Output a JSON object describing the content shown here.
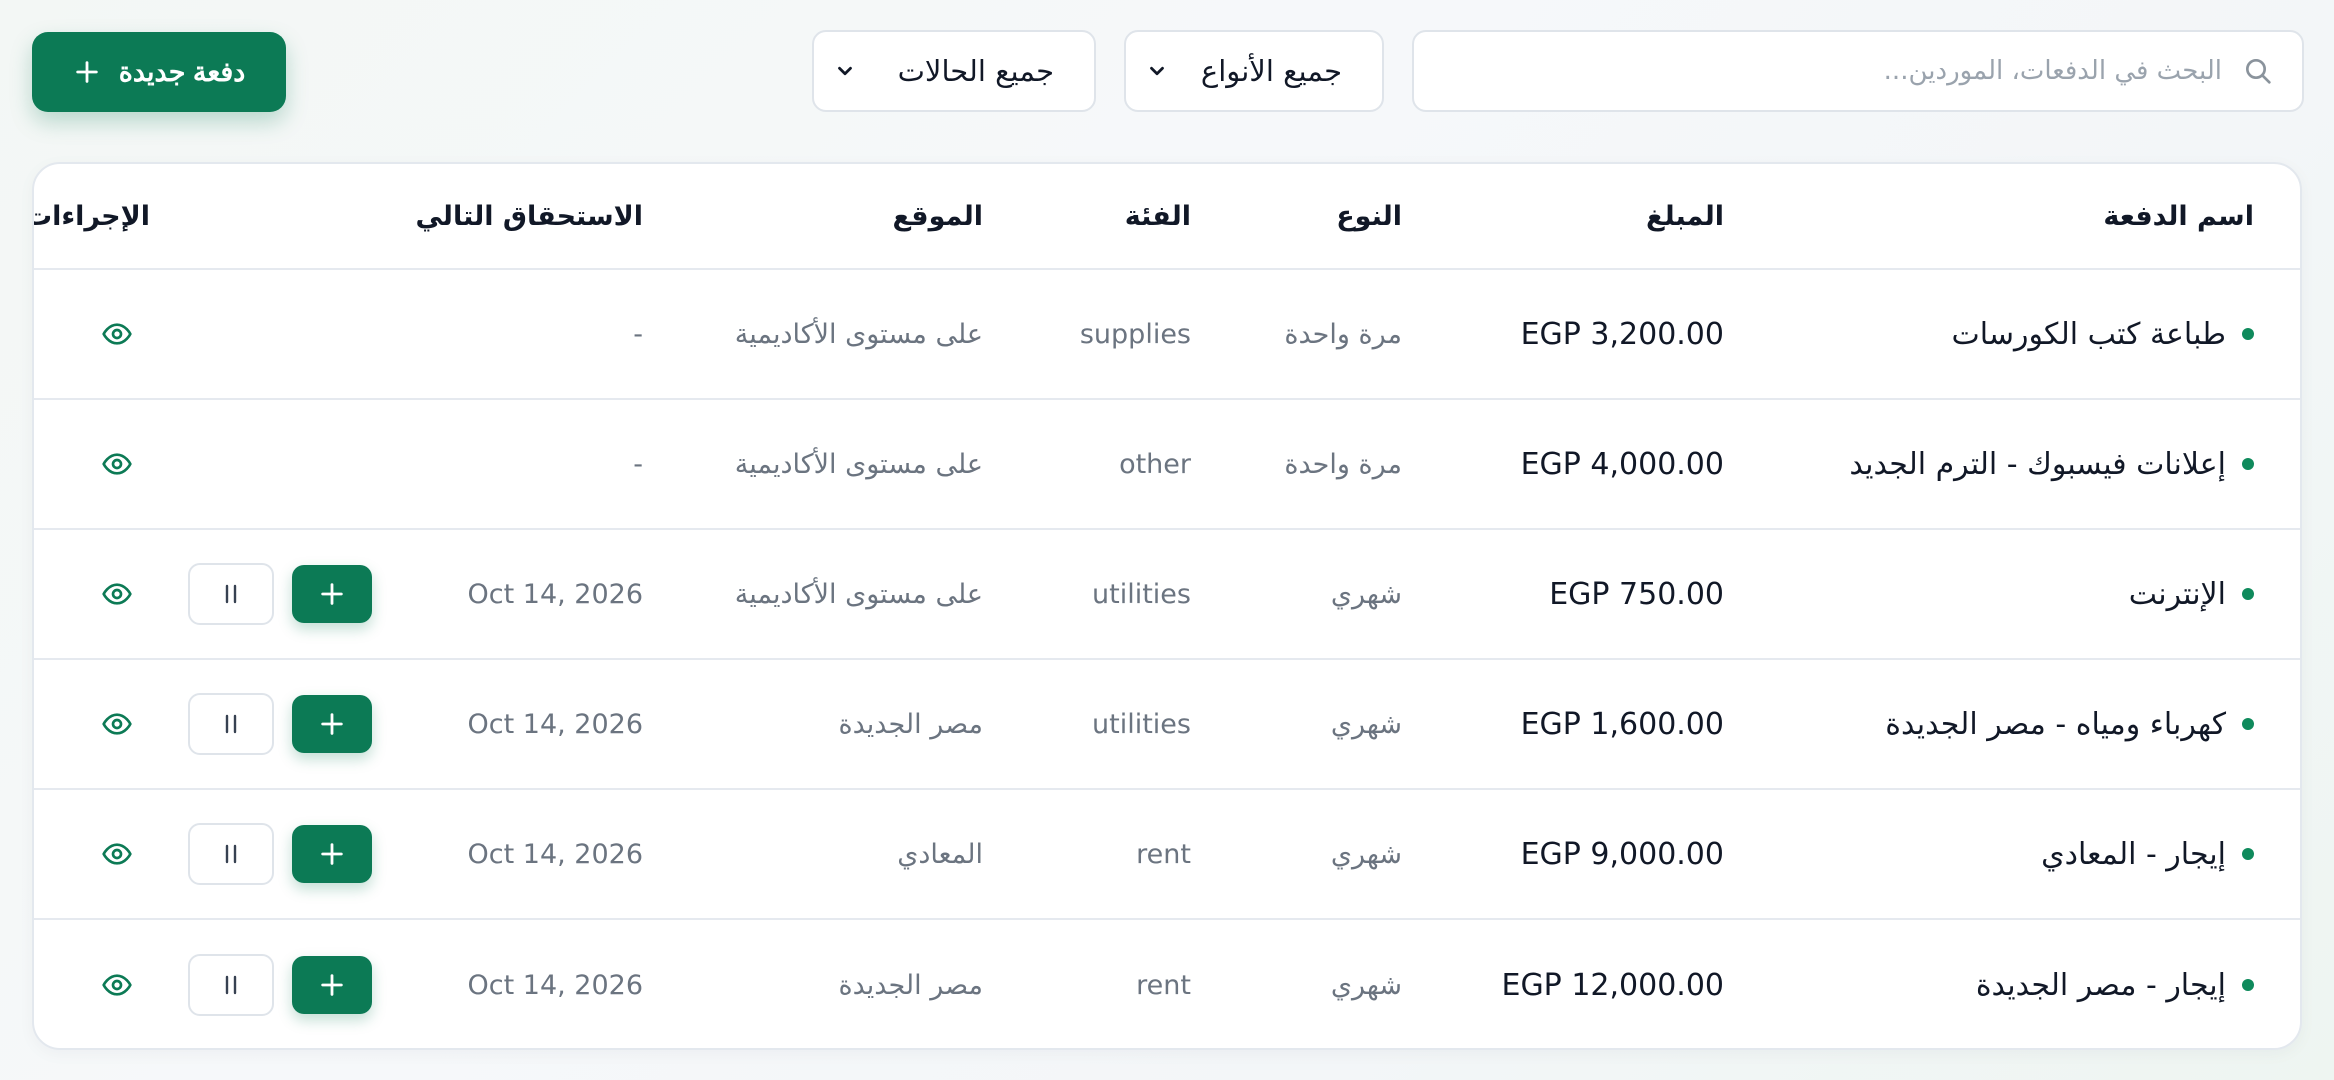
{
  "toolbar": {
    "search_placeholder": "البحث في الدفعات، الموردين...",
    "type_filter": "جميع الأنواع",
    "status_filter": "جميع الحالات",
    "new_payment_label": "دفعة جديدة"
  },
  "table": {
    "headers": {
      "name": "اسم الدفعة",
      "amount": "المبلغ",
      "type": "النوع",
      "category": "الفئة",
      "location": "الموقع",
      "next_due": "الاستحقاق التالي",
      "actions": "الإجراءات"
    },
    "rows": [
      {
        "name": "طباعة كتب الكورسات",
        "amount": "EGP 3,200.00",
        "type": "مرة واحدة",
        "category": "supplies",
        "location": "على مستوى الأكاديمية",
        "next_due": "-"
      },
      {
        "name": "إعلانات فيسبوك - الترم الجديد",
        "amount": "EGP 4,000.00",
        "type": "مرة واحدة",
        "category": "other",
        "location": "على مستوى الأكاديمية",
        "next_due": "-"
      },
      {
        "name": "الإنترنت",
        "amount": "EGP 750.00",
        "type": "شهري",
        "category": "utilities",
        "location": "على مستوى الأكاديمية",
        "next_due": "Oct 14, 2026"
      },
      {
        "name": "كهرباء ومياه - مصر الجديدة",
        "amount": "EGP 1,600.00",
        "type": "شهري",
        "category": "utilities",
        "location": "مصر الجديدة",
        "next_due": "Oct 14, 2026"
      },
      {
        "name": "إيجار - المعادي",
        "amount": "EGP 9,000.00",
        "type": "شهري",
        "category": "rent",
        "location": "المعادي",
        "next_due": "Oct 14, 2026"
      },
      {
        "name": "إيجار - مصر الجديدة",
        "amount": "EGP 12,000.00",
        "type": "شهري",
        "category": "rent",
        "location": "مصر الجديدة",
        "next_due": "Oct 14, 2026"
      }
    ]
  },
  "icons": {
    "search": "search-icon",
    "chevron": "chevron-down-icon",
    "plus": "plus-icon",
    "view": "eye-icon",
    "pause": "pause-icon"
  },
  "colors": {
    "accent": "#0c7a55",
    "status_dot": "#0f8a5c",
    "border": "#dfe4ea",
    "muted_text": "#6b7480"
  }
}
